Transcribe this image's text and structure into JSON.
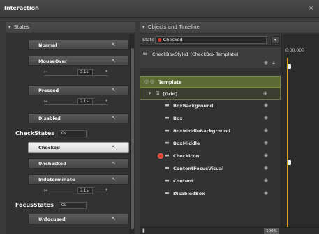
{
  "window": {
    "title": "Interaction",
    "close_glyph": "×"
  },
  "states_panel": {
    "header": "States",
    "rows": [
      {
        "label": "Normal",
        "icon": "arrow-icon"
      },
      {
        "label": "MouseOver",
        "icon": "arrow-icon"
      },
      {
        "label": "Pressed",
        "icon": "arrow-icon"
      },
      {
        "label": "Disabled",
        "icon": "arrow-icon"
      }
    ],
    "transition_value": "0.1s",
    "checkstates": {
      "name": "CheckStates",
      "value": "0s",
      "rows": [
        {
          "label": "Checked",
          "selected": true
        },
        {
          "label": "Unchecked",
          "selected": false
        },
        {
          "label": "Indeterminate",
          "selected": false
        }
      ],
      "transition_value": "0.1s"
    },
    "focusstates": {
      "name": "FocusStates",
      "value": "0s",
      "rows": [
        {
          "label": "Unfocused"
        }
      ]
    }
  },
  "objects_panel": {
    "header": "Objects and Timeline",
    "state_label": "State:",
    "state_value": "Checked",
    "root_title": "CheckBoxStyle1 (CheckBox Template)",
    "timeline_time": "0:00.000",
    "zoom": "100%",
    "tree": [
      {
        "name": "Template",
        "kind": "template"
      },
      {
        "name": "[Grid]",
        "kind": "grid"
      },
      {
        "name": "BoxBackground",
        "kind": "item"
      },
      {
        "name": "Box",
        "kind": "item"
      },
      {
        "name": "BoxMiddleBackground",
        "kind": "item"
      },
      {
        "name": "BoxMiddle",
        "kind": "item"
      },
      {
        "name": "CheckIcon",
        "kind": "recording"
      },
      {
        "name": "ContentFocusVisual",
        "kind": "item"
      },
      {
        "name": "Content",
        "kind": "item"
      },
      {
        "name": "DisabledBox",
        "kind": "item"
      }
    ]
  },
  "colors": {
    "accent_playhead": "#e0a020",
    "record_red": "#d83a2e",
    "template_green": "#5b6b33"
  }
}
